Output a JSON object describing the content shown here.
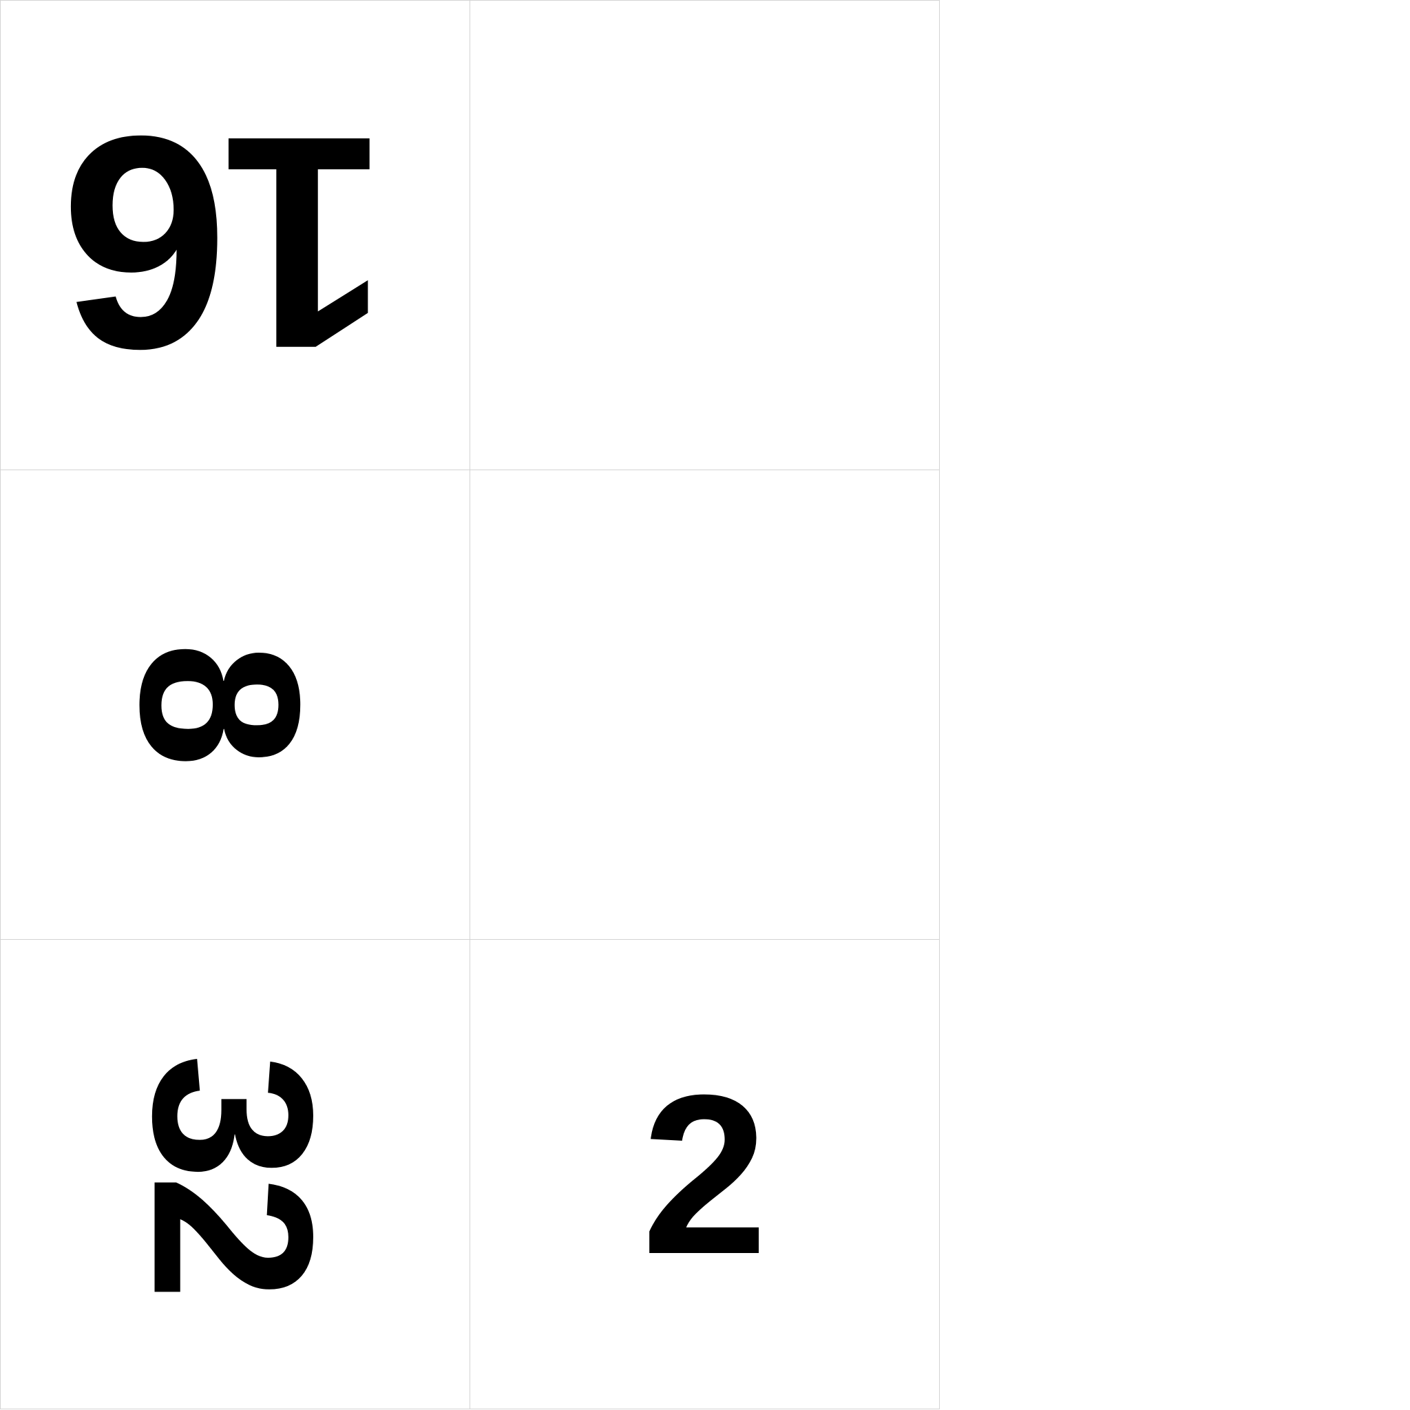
{
  "board": {
    "rows": 3,
    "cols": 2,
    "tiles": [
      {
        "row": 0,
        "col": 0,
        "value": "16",
        "orientation": "rotated-180"
      },
      {
        "row": 0,
        "col": 1,
        "value": "",
        "orientation": "none"
      },
      {
        "row": 1,
        "col": 0,
        "value": "8",
        "orientation": "rotated-90"
      },
      {
        "row": 1,
        "col": 1,
        "value": "",
        "orientation": "none"
      },
      {
        "row": 2,
        "col": 0,
        "value": "32",
        "orientation": "rotated-90"
      },
      {
        "row": 2,
        "col": 1,
        "value": "2",
        "orientation": "upright"
      }
    ]
  },
  "colors": {
    "background": "#ffffff",
    "tile_border": "#d3d3d3",
    "digit": "#000000"
  }
}
